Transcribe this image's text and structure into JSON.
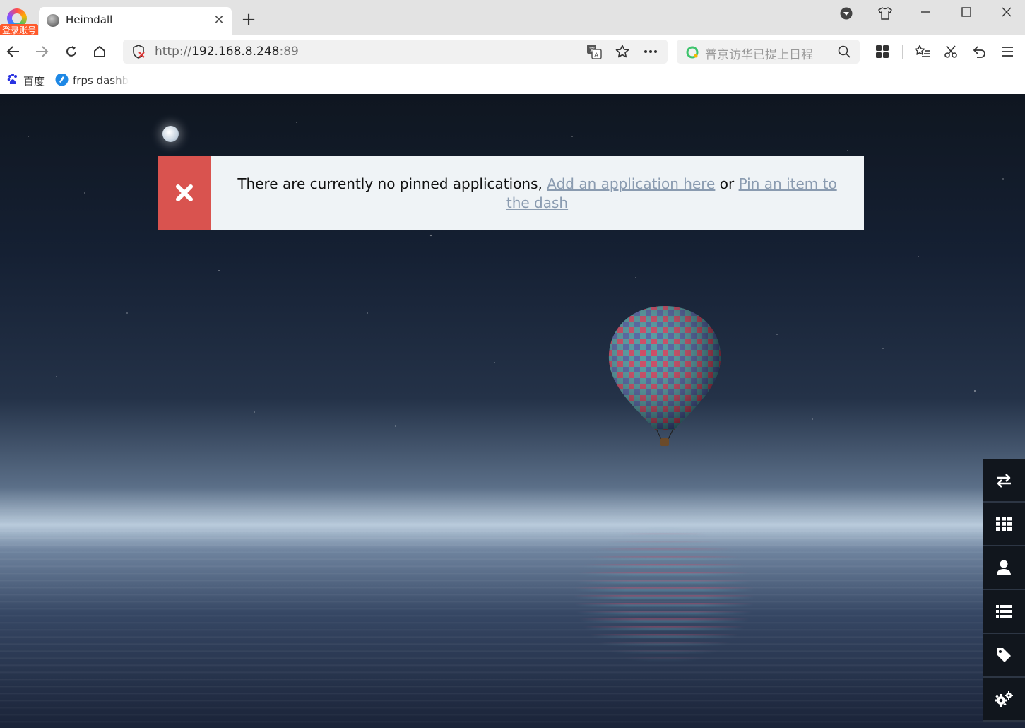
{
  "browser": {
    "profile_badge": "登录账号",
    "tab": {
      "title": "Heimdall"
    },
    "url": {
      "scheme": "http://",
      "host": "192.168.8.248",
      "port": ":89"
    },
    "search_placeholder": "普京访华已提上日程",
    "bookmarks": [
      {
        "label": "百度",
        "icon": "baidu-paw-icon"
      },
      {
        "label": "frps dashb",
        "icon": "frps-logo-icon"
      }
    ]
  },
  "notice": {
    "text_before": "There are currently no pinned applications, ",
    "link_add": "Add an application here",
    "text_middle": " or ",
    "link_pin": "Pin an item to the dash",
    "accent_color": "#d9534f"
  },
  "dock": [
    {
      "name": "switch-view-icon"
    },
    {
      "name": "apps-grid-icon"
    },
    {
      "name": "user-icon"
    },
    {
      "name": "list-icon"
    },
    {
      "name": "tag-icon"
    },
    {
      "name": "settings-cogs-icon"
    }
  ]
}
